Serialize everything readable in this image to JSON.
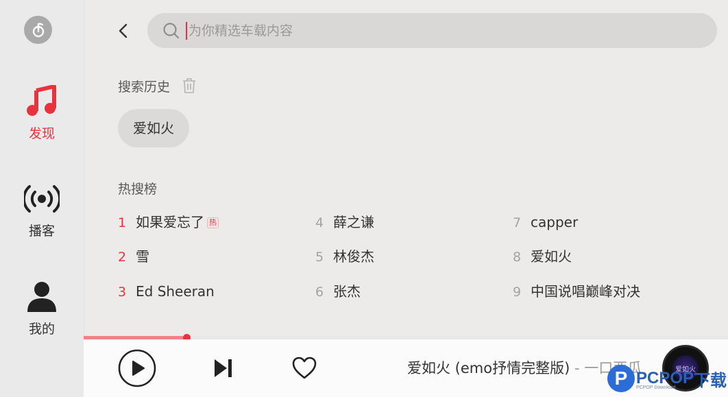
{
  "sidebar": {
    "logo_icon": "netease-music-logo",
    "items": [
      {
        "label": "发现",
        "icon": "music-note-icon",
        "active": true
      },
      {
        "label": "播客",
        "icon": "podcast-broadcast-icon",
        "active": false
      },
      {
        "label": "我的",
        "icon": "user-icon",
        "active": false
      }
    ]
  },
  "search": {
    "placeholder": "为你精选车载内容",
    "value": ""
  },
  "history": {
    "title": "搜索历史",
    "items": [
      "爱如火"
    ]
  },
  "hot": {
    "title": "热搜榜",
    "badge": "热",
    "items": [
      {
        "rank": "1",
        "title": "如果爱忘了"
      },
      {
        "rank": "2",
        "title": "雪"
      },
      {
        "rank": "3",
        "title": "Ed Sheeran"
      },
      {
        "rank": "4",
        "title": "薛之谦"
      },
      {
        "rank": "5",
        "title": "林俊杰"
      },
      {
        "rank": "6",
        "title": "张杰"
      },
      {
        "rank": "7",
        "title": "capper"
      },
      {
        "rank": "8",
        "title": "爱如火"
      },
      {
        "rank": "9",
        "title": "中国说唱巅峰对决"
      }
    ]
  },
  "player": {
    "progress": 0.16,
    "song": "爱如火 (emo抒情完整版)",
    "artist": " - 一口西瓜",
    "album_art_text": "爱如火",
    "accent_color": "#e8333f"
  },
  "watermark": {
    "brand": "PCPOP",
    "suffix": "下载",
    "sub": "PCPOP Download"
  }
}
